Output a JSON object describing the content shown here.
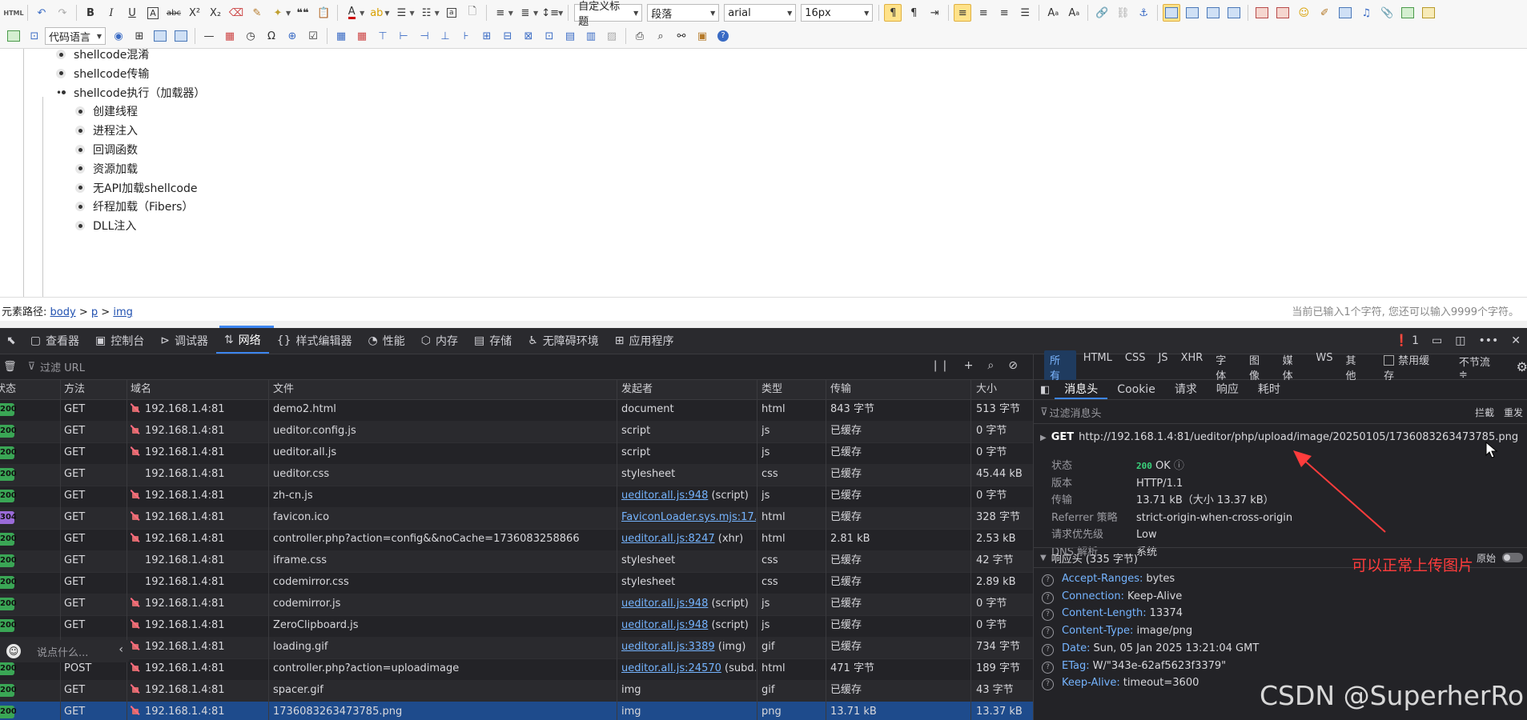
{
  "toolbar": {
    "html_label": "HTML",
    "row1_formats": {
      "bold": "B",
      "italic": "I",
      "underline": "U",
      "fontborder": "A",
      "strike": "abc",
      "superscript": "X²",
      "subscript": "X₂",
      "quote": "❝❝",
      "forecolor": "A",
      "emotion_a1": "A",
      "emotion_a2": "A"
    },
    "custom_style": "自定义标题",
    "paragraph": "段落",
    "font_family": "arial",
    "font_size": "16px",
    "code_language": "代码语言"
  },
  "editor": {
    "items": [
      {
        "text": "shellcode混淆",
        "level": 1,
        "bullet": "filled"
      },
      {
        "text": "shellcode传输",
        "level": 1,
        "bullet": "filled"
      },
      {
        "text": "shellcode执行（加载器）",
        "level": 1,
        "bullet": "plain"
      },
      {
        "text": "创建线程",
        "level": 2,
        "bullet": "filled"
      },
      {
        "text": "进程注入",
        "level": 2,
        "bullet": "filled"
      },
      {
        "text": "回调函数",
        "level": 2,
        "bullet": "filled"
      },
      {
        "text": "资源加载",
        "level": 2,
        "bullet": "filled"
      },
      {
        "text": "无API加载shellcode",
        "level": 2,
        "bullet": "filled"
      },
      {
        "text": "纤程加载（Fibers）",
        "level": 2,
        "bullet": "filled"
      },
      {
        "text": "DLL注入",
        "level": 2,
        "bullet": "filled"
      }
    ]
  },
  "statusline": {
    "label": "元素路径:",
    "path": [
      "body",
      "p",
      "img"
    ],
    "sep": ">",
    "count_text": "当前已输入1个字符, 您还可以输入9999个字符。"
  },
  "devtools": {
    "tabs": [
      {
        "label": "查看器",
        "icon": "inspector-icon"
      },
      {
        "label": "控制台",
        "icon": "console-icon"
      },
      {
        "label": "调试器",
        "icon": "debugger-icon"
      },
      {
        "label": "网络",
        "icon": "network-icon",
        "active": true
      },
      {
        "label": "样式编辑器",
        "icon": "style-editor-icon"
      },
      {
        "label": "性能",
        "icon": "performance-icon"
      },
      {
        "label": "内存",
        "icon": "memory-icon"
      },
      {
        "label": "存储",
        "icon": "storage-icon"
      },
      {
        "label": "无障碍环境",
        "icon": "accessibility-icon"
      },
      {
        "label": "应用程序",
        "icon": "application-icon"
      }
    ],
    "error_count": "1",
    "filter_placeholder": "过滤 URL",
    "type_filters": [
      "所有",
      "HTML",
      "CSS",
      "JS",
      "XHR",
      "字体",
      "图像",
      "媒体",
      "WS",
      "其他"
    ],
    "disable_cache": "禁用缓存",
    "throttle": "不节流 ≑",
    "columns": [
      "状态",
      "方法",
      "域名",
      "文件",
      "发起者",
      "类型",
      "传输",
      "大小"
    ],
    "rows": [
      {
        "status": "200",
        "method": "GET",
        "domain": "192.168.1.4:81",
        "insecure": true,
        "file": "demo2.html",
        "initiator": "document",
        "initiator_link": false,
        "type": "html",
        "transfer": "843 字节",
        "size": "513 字节"
      },
      {
        "status": "200",
        "method": "GET",
        "domain": "192.168.1.4:81",
        "insecure": true,
        "file": "ueditor.config.js",
        "initiator": "script",
        "initiator_link": false,
        "type": "js",
        "transfer": "已缓存",
        "size": "0 字节"
      },
      {
        "status": "200",
        "method": "GET",
        "domain": "192.168.1.4:81",
        "insecure": true,
        "file": "ueditor.all.js",
        "initiator": "script",
        "initiator_link": false,
        "type": "js",
        "transfer": "已缓存",
        "size": "0 字节"
      },
      {
        "status": "200",
        "method": "GET",
        "domain": "192.168.1.4:81",
        "insecure": false,
        "file": "ueditor.css",
        "initiator": "stylesheet",
        "initiator_link": false,
        "type": "css",
        "transfer": "已缓存",
        "size": "45.44 kB"
      },
      {
        "status": "200",
        "method": "GET",
        "domain": "192.168.1.4:81",
        "insecure": true,
        "file": "zh-cn.js",
        "initiator": "ueditor.all.js:948",
        "initiator_suffix": " (script)",
        "initiator_link": true,
        "type": "js",
        "transfer": "已缓存",
        "size": "0 字节"
      },
      {
        "status": "304",
        "method": "GET",
        "domain": "192.168.1.4:81",
        "insecure": true,
        "file": "favicon.ico",
        "initiator": "FaviconLoader.sys.mjs:17...",
        "initiator_link": true,
        "type": "html",
        "transfer": "已缓存",
        "size": "328 字节"
      },
      {
        "status": "200",
        "method": "GET",
        "domain": "192.168.1.4:81",
        "insecure": true,
        "file": "controller.php?action=config&&noCache=1736083258866",
        "initiator": "ueditor.all.js:8247",
        "initiator_suffix": " (xhr)",
        "initiator_link": true,
        "type": "html",
        "transfer": "2.81 kB",
        "size": "2.53 kB"
      },
      {
        "status": "200",
        "method": "GET",
        "domain": "192.168.1.4:81",
        "insecure": false,
        "file": "iframe.css",
        "initiator": "stylesheet",
        "initiator_link": false,
        "type": "css",
        "transfer": "已缓存",
        "size": "42 字节"
      },
      {
        "status": "200",
        "method": "GET",
        "domain": "192.168.1.4:81",
        "insecure": false,
        "file": "codemirror.css",
        "initiator": "stylesheet",
        "initiator_link": false,
        "type": "css",
        "transfer": "已缓存",
        "size": "2.89 kB"
      },
      {
        "status": "200",
        "method": "GET",
        "domain": "192.168.1.4:81",
        "insecure": true,
        "file": "codemirror.js",
        "initiator": "ueditor.all.js:948",
        "initiator_suffix": " (script)",
        "initiator_link": true,
        "type": "js",
        "transfer": "已缓存",
        "size": "0 字节"
      },
      {
        "status": "200",
        "method": "GET",
        "domain": "192.168.1.4:81",
        "insecure": true,
        "file": "ZeroClipboard.js",
        "initiator": "ueditor.all.js:948",
        "initiator_suffix": " (script)",
        "initiator_link": true,
        "type": "js",
        "transfer": "已缓存",
        "size": "0 字节"
      },
      {
        "status": "200",
        "method": "GET",
        "domain": "192.168.1.4:81",
        "insecure": true,
        "file": "loading.gif",
        "initiator": "ueditor.all.js:3389",
        "initiator_suffix": " (img)",
        "initiator_link": true,
        "type": "gif",
        "transfer": "已缓存",
        "size": "734 字节"
      },
      {
        "status": "200",
        "method": "POST",
        "domain": "192.168.1.4:81",
        "insecure": true,
        "file": "controller.php?action=uploadimage",
        "initiator": "ueditor.all.js:24570",
        "initiator_suffix": " (subd...",
        "initiator_link": true,
        "type": "html",
        "transfer": "471 字节",
        "size": "189 字节"
      },
      {
        "status": "200",
        "method": "GET",
        "domain": "192.168.1.4:81",
        "insecure": true,
        "file": "spacer.gif",
        "initiator": "img",
        "initiator_link": false,
        "type": "gif",
        "transfer": "已缓存",
        "size": "43 字节"
      },
      {
        "status": "200",
        "method": "GET",
        "domain": "192.168.1.4:81",
        "insecure": true,
        "file": "1736083263473785.png",
        "initiator": "img",
        "initiator_link": false,
        "type": "png",
        "transfer": "13.71 kB",
        "size": "13.37 kB",
        "selected": true
      }
    ],
    "chat_placeholder": "说点什么...",
    "side": {
      "tabs": [
        "消息头",
        "Cookie",
        "请求",
        "响应",
        "耗时"
      ],
      "filter_placeholder": "过滤消息头",
      "block_label": "拦截",
      "resend_label": "重发",
      "request_verb": "GET",
      "request_url": "http://192.168.1.4:81/ueditor/php/upload/image/20250105/1736083263473785.png",
      "summary": [
        {
          "k": "状态",
          "v": "OK",
          "code": "200"
        },
        {
          "k": "版本",
          "v": "HTTP/1.1"
        },
        {
          "k": "传输",
          "v": "13.71 kB（大小 13.37 kB）"
        },
        {
          "k": "Referrer 策略",
          "v": "strict-origin-when-cross-origin"
        },
        {
          "k": "请求优先级",
          "v": "Low"
        },
        {
          "k": "DNS 解析",
          "v": "系统"
        }
      ],
      "response_headers_title": "响应头 (335 字节)",
      "raw_label": "原始",
      "headers": [
        {
          "k": "Accept-Ranges:",
          "v": "bytes"
        },
        {
          "k": "Connection:",
          "v": "Keep-Alive"
        },
        {
          "k": "Content-Length:",
          "v": "13374"
        },
        {
          "k": "Content-Type:",
          "v": "image/png"
        },
        {
          "k": "Date:",
          "v": "Sun, 05 Jan 2025 13:21:04 GMT"
        },
        {
          "k": "ETag:",
          "v": "W/\"343e-62af5623f3379\""
        },
        {
          "k": "Keep-Alive:",
          "v": "timeout=3600"
        }
      ]
    }
  },
  "annotation": "可以正常上传图片",
  "watermark": "CSDN @SuperherRo",
  "colors": {
    "accent": "#3d86f0",
    "annotation": "#ff3c3c",
    "status_ok": "#3aa655",
    "status_304": "#9a6bd8",
    "selected_row": "#1e4b8c"
  }
}
